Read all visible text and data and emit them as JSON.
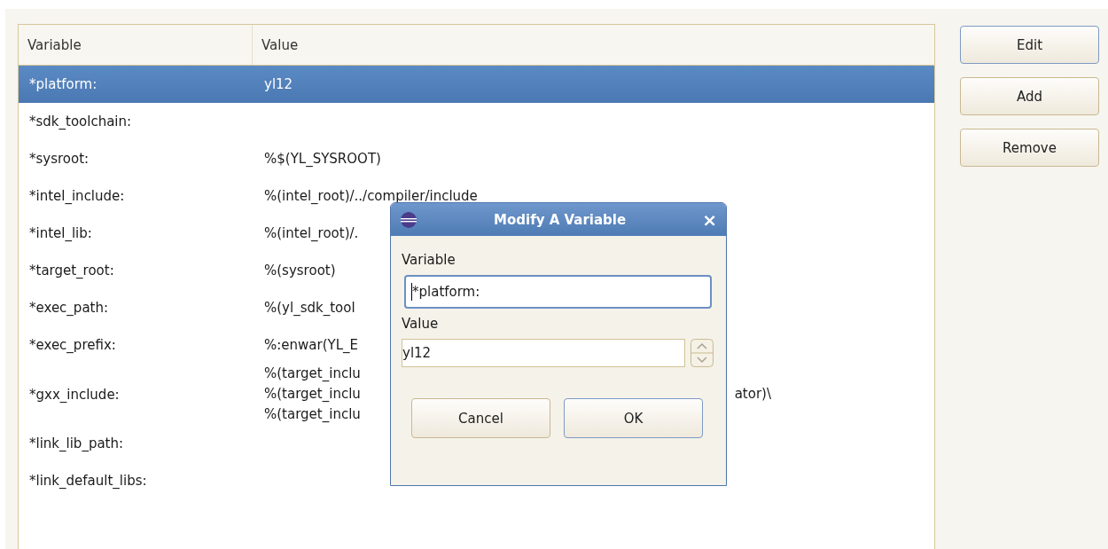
{
  "table": {
    "columns": [
      "Variable",
      "Value"
    ],
    "rows": [
      {
        "variable": "*platform:",
        "value_lines": [
          {
            "text": "yl12"
          }
        ],
        "selected": true
      },
      {
        "variable": "*sdk_toolchain:",
        "value_lines": [],
        "selected": false
      },
      {
        "variable": "*sysroot:",
        "value_lines": [
          {
            "text": "%$(YL_SYSROOT)"
          }
        ],
        "selected": false
      },
      {
        "variable": "*intel_include:",
        "value_lines": [
          {
            "text": "%(intel_root)/../compiler/include"
          }
        ],
        "selected": false
      },
      {
        "variable": "*intel_lib:",
        "value_lines": [
          {
            "text": "%(intel_root)/."
          }
        ],
        "selected": false
      },
      {
        "variable": "*target_root:",
        "value_lines": [
          {
            "text": "%(sysroot)"
          }
        ],
        "selected": false
      },
      {
        "variable": "*exec_path:",
        "value_lines": [
          {
            "text": "%(yl_sdk_tool"
          }
        ],
        "selected": false
      },
      {
        "variable": "*exec_prefix:",
        "value_lines": [
          {
            "text": "%:enwar(YL_E"
          }
        ],
        "selected": false
      },
      {
        "variable": "*gxx_include:",
        "value_lines": [
          {
            "text": "%(target_inclu"
          },
          {
            "text": "%(target_inclu",
            "tail": "ator)\\"
          },
          {
            "text": "%(target_inclu"
          }
        ],
        "selected": false
      },
      {
        "variable": "*link_lib_path:",
        "value_lines": [],
        "selected": false
      },
      {
        "variable": "*link_default_libs:",
        "value_lines": [],
        "selected": false
      }
    ]
  },
  "buttons": [
    {
      "label": "Edit",
      "focused": true
    },
    {
      "label": "Add",
      "focused": false
    },
    {
      "label": "Remove",
      "focused": false
    }
  ],
  "dialog": {
    "title": "Modify A Variable",
    "close": "×",
    "variable_label": "Variable",
    "variable_value": "*platform:",
    "variable_focused": true,
    "value_label": "Value",
    "value_value": "yl12",
    "buttons": [
      {
        "label": "Cancel",
        "focused": false
      },
      {
        "label": "OK",
        "focused": true
      }
    ]
  }
}
